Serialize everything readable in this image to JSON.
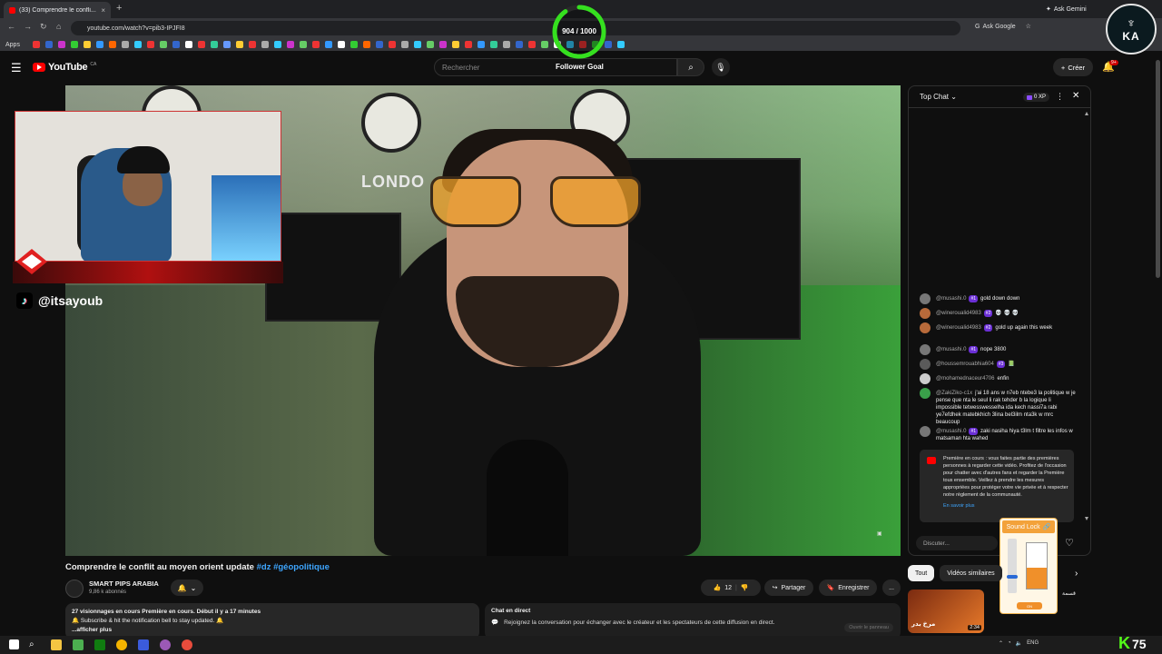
{
  "browser": {
    "tab_title": "(33) Comprendre le confli...",
    "url": "youtube.com/watch?v=pib3-IPJFI8",
    "ask_google": "Ask Google",
    "ask_gemini": "Ask Gemini",
    "bookmarks_apps": "Apps"
  },
  "overlay": {
    "goal_text": "904 / 1000",
    "goal_progress": 0.904,
    "goal_color": "#35e01f",
    "tiktok_handle": "@itsayoub",
    "video_text": "LONDO"
  },
  "header": {
    "logo": "YouTube",
    "logo_region": "CA",
    "search_placeholder": "Rechercher",
    "follower_goal": "Follower Goal",
    "create_label": "Créer",
    "notif_count": "9+"
  },
  "video": {
    "title_text": "Comprendre le conflit au moyen orient update ",
    "tags": "#dz #géopolitique",
    "channel_name": "SMART PIPS ARABIA",
    "subscribers": "9,86 k abonnés",
    "likes": "12",
    "share_label": "Partager",
    "save_label": "Enregistrer",
    "more": "..."
  },
  "description": {
    "line1_bold": "27 visionnages en cours  Première en cours. Début il y a 17 minutes",
    "line2": "🔔 Subscribe & hit the notification bell to stay updated. 🔔",
    "line3": "...afficher plus"
  },
  "livechat": {
    "title": "Chat en direct",
    "text": "Rejoignez la conversation pour échanger avec le créateur et les spectateurs de cette diffusion en direct.",
    "button": "Ouvrir le panneau"
  },
  "chat": {
    "mode": "Top Chat",
    "xp": "0 XP",
    "input_placeholder": "Discuter...",
    "messages": [
      {
        "author": "@musashi.0",
        "badge": "#1",
        "text": "gold down down",
        "avatar_color": "#777777"
      },
      {
        "author": "@wineroualid4983",
        "badge": "#2",
        "text": "💀 💀 💀",
        "avatar_color": "#b86a3a"
      },
      {
        "author": "@wineroualid4983",
        "badge": "#2",
        "text": "gold up again this week",
        "avatar_color": "#b86a3a"
      },
      {
        "author": "@musashi.0",
        "badge": "#1",
        "text": "nope 3800",
        "avatar_color": "#777777"
      },
      {
        "author": "@houssemrouabhia604",
        "badge": "#3",
        "text": "📗",
        "avatar_color": "#5a5a5a"
      },
      {
        "author": "@mohamednaceur4706",
        "badge": "",
        "text": "enfin",
        "avatar_color": "#cccccc"
      },
      {
        "author": "@ZakiZiko-c1x",
        "badge": "",
        "text": "j'ai 18 ans w n7eb ntebe3 la politique w je pense que nta le seul li rak tehder b la logique li impossible tetwesswesselha ida kech nassi7a rabi ye7efdhek matebkhich 3lina bel3ilm nta3k w mrc beaucoup",
        "avatar_color": "#3aa04a"
      },
      {
        "author": "@musashi.0",
        "badge": "#1",
        "text": "zaki nasiha hiya t3lm t filtre les infos w matsaman hta wahed",
        "avatar_color": "#777777"
      }
    ],
    "notice": "Première en cours : vous faites partie des premières personnes à regarder cette vidéo. Profitez de l'occasion pour chatter avec d'autres fans et regarder la Première tous ensemble. Veillez à prendre les mesures appropriées pour protéger votre vie privée et à respecter notre règlement de la communauté.",
    "notice_link": "En savoir plus"
  },
  "soundlock": {
    "title": "Sound Lock",
    "level": 0.45,
    "footer": "ON"
  },
  "suggestions": {
    "chips": [
      "Tout",
      "Vidéos similaires"
    ],
    "thumb_title": "مرخ بدر",
    "duration": "2:34",
    "side_text": "قسمة"
  },
  "taskbar": {
    "lang": "ENG",
    "kick_count": "75"
  },
  "toplogo": {
    "letters": "KA"
  }
}
